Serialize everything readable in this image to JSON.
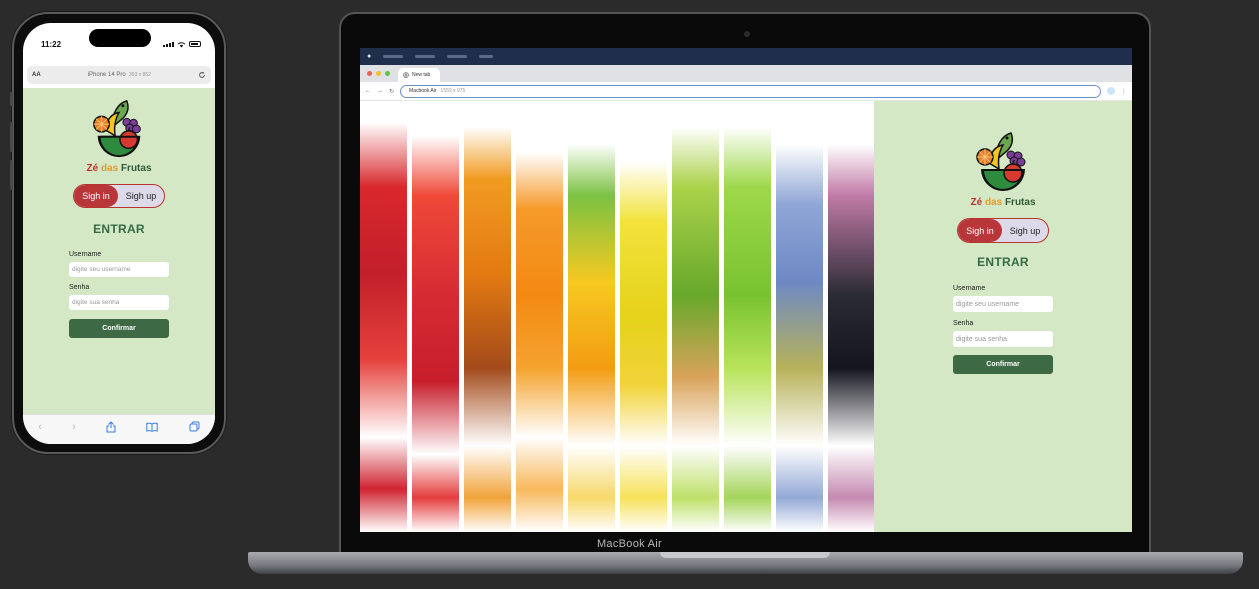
{
  "phone": {
    "time": "11:22",
    "address": {
      "aa_label": "AA",
      "device_name": "iPhone 14 Pro",
      "device_size": "393 x 852",
      "reload_icon": "reload-icon"
    },
    "toolbar": [
      "back-chevron-icon",
      "forward-chevron-icon",
      "share-icon",
      "bookmarks-icon",
      "tabs-icon"
    ]
  },
  "login": {
    "brand": {
      "ze": "Zé",
      "das": "das",
      "frutas": "Frutas"
    },
    "signin_label": "Sigh in",
    "signup_label": "Sigh up",
    "heading": "ENTRAR",
    "username_label": "Username",
    "username_placeholder": "digite seu username",
    "password_label": "Senha",
    "password_placeholder": "digite sua senha",
    "confirm_label": "Confirmar"
  },
  "laptop": {
    "tab_title": "New tab",
    "url_device": "Macbook Air",
    "url_size": "1559 x 975",
    "base_label": "MacBook Air"
  },
  "colors": {
    "page_bg": "#d4e8c6",
    "accent_red": "#b8363a",
    "heading_green": "#356b40",
    "button_green": "#3d6a44",
    "frame_bg": "#2b2b2b"
  }
}
